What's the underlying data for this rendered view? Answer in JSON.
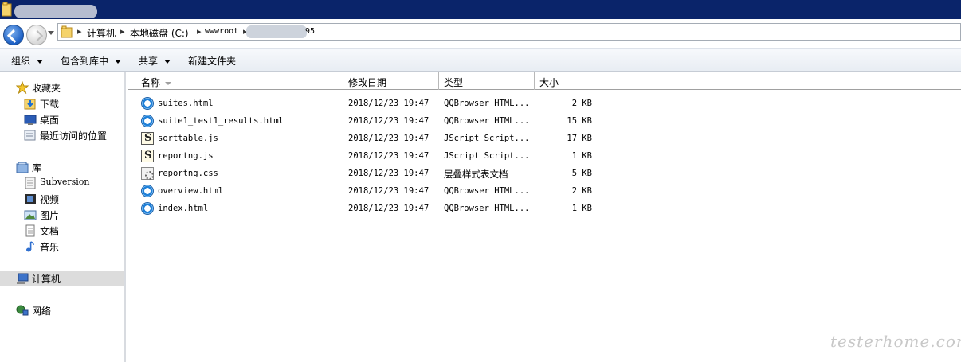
{
  "address_bar": {
    "crumbs": [
      "计算机",
      "本地磁盘 (C:)",
      "wwwroot",
      "95"
    ]
  },
  "toolbar": {
    "organize": "组织",
    "include_in_library": "包含到库中",
    "share": "共享",
    "new_folder": "新建文件夹"
  },
  "nav": {
    "favorites": "收藏夹",
    "downloads": "下载",
    "desktop": "桌面",
    "recent": "最近访问的位置",
    "libraries": "库",
    "subversion": "Subversion",
    "videos": "视频",
    "pictures": "图片",
    "documents": "文档",
    "music": "音乐",
    "computer": "计算机",
    "network": "网络"
  },
  "columns": {
    "name": "名称",
    "modified": "修改日期",
    "type": "类型",
    "size": "大小"
  },
  "files": [
    {
      "name": "suites.html",
      "date": "2018/12/23 19:47",
      "type": "QQBrowser HTML...",
      "size": "2 KB",
      "icon": "qqbrowser-html-icon"
    },
    {
      "name": "suite1_test1_results.html",
      "date": "2018/12/23 19:47",
      "type": "QQBrowser HTML...",
      "size": "15 KB",
      "icon": "qqbrowser-html-icon"
    },
    {
      "name": "sorttable.js",
      "date": "2018/12/23 19:47",
      "type": "JScript Script...",
      "size": "17 KB",
      "icon": "jscript-file-icon"
    },
    {
      "name": "reportng.js",
      "date": "2018/12/23 19:47",
      "type": "JScript Script...",
      "size": "1 KB",
      "icon": "jscript-file-icon"
    },
    {
      "name": "reportng.css",
      "date": "2018/12/23 19:47",
      "type": "层叠样式表文档",
      "size": "5 KB",
      "icon": "css-file-icon"
    },
    {
      "name": "overview.html",
      "date": "2018/12/23 19:47",
      "type": "QQBrowser HTML...",
      "size": "2 KB",
      "icon": "qqbrowser-html-icon"
    },
    {
      "name": "index.html",
      "date": "2018/12/23 19:47",
      "type": "QQBrowser HTML...",
      "size": "1 KB",
      "icon": "qqbrowser-html-icon"
    }
  ],
  "watermark": "testerhome.com",
  "colors": {
    "titlebar": "#0a246a",
    "selection_bg": "#dcdcdc"
  }
}
